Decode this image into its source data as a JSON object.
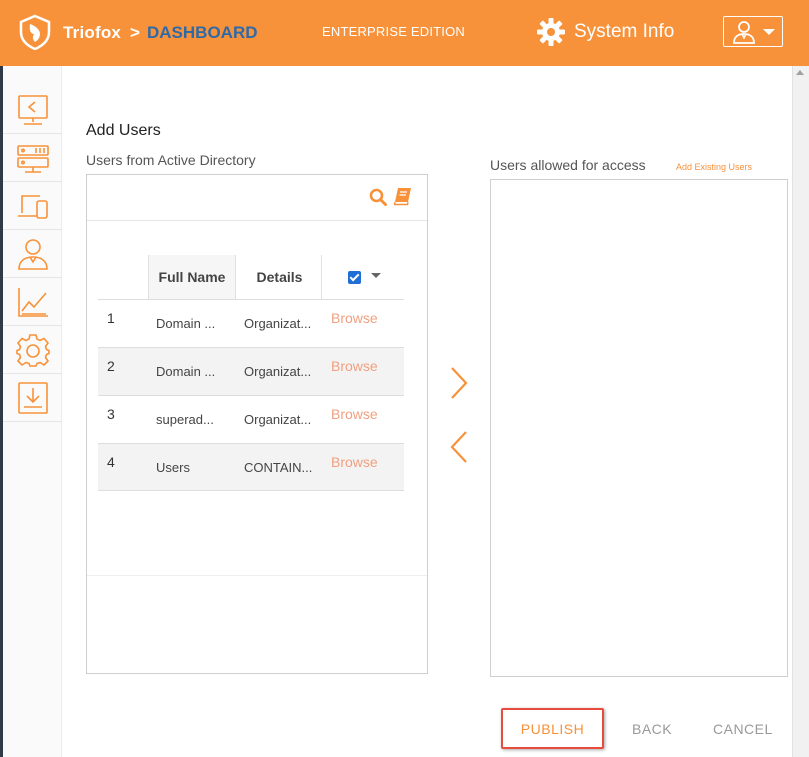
{
  "header": {
    "brand": "Triofox",
    "separator": ">",
    "breadcrumb": "DASHBOARD",
    "edition": "ENTERPRISE EDITION",
    "system_info": "System Info",
    "icons": {
      "logo": "triofox-shield-logo",
      "gear": "gear-icon",
      "user": "user-icon"
    }
  },
  "sidebar": {
    "items": [
      {
        "icon": "share-folder-icon"
      },
      {
        "icon": "server-icon"
      },
      {
        "icon": "devices-icon"
      },
      {
        "icon": "users-icon"
      },
      {
        "icon": "chart-icon"
      },
      {
        "icon": "settings-icon"
      },
      {
        "icon": "download-icon"
      }
    ]
  },
  "main": {
    "title": "Add Users",
    "ad_label": "Users from Active Directory",
    "allowed_label": "Users allowed for access",
    "add_existing": "Add Existing Users",
    "table": {
      "columns": {
        "name": "Full Name",
        "details": "Details"
      },
      "rows": [
        {
          "num": "1",
          "name": "Domain ...",
          "details": "Organizat...",
          "action": "Browse"
        },
        {
          "num": "2",
          "name": "Domain ...",
          "details": "Organizat...",
          "action": "Browse"
        },
        {
          "num": "3",
          "name": "superad...",
          "details": "Organizat...",
          "action": "Browse"
        },
        {
          "num": "4",
          "name": "Users",
          "details": "CONTAIN...",
          "action": "Browse"
        }
      ]
    }
  },
  "footer": {
    "publish": "PUBLISH",
    "back": "BACK",
    "cancel": "CANCEL"
  },
  "colors": {
    "accent": "#f7923a",
    "breadcrumb": "#2e6aa8",
    "highlight_border": "#e74c3c",
    "browse_link": "#f0a080"
  }
}
